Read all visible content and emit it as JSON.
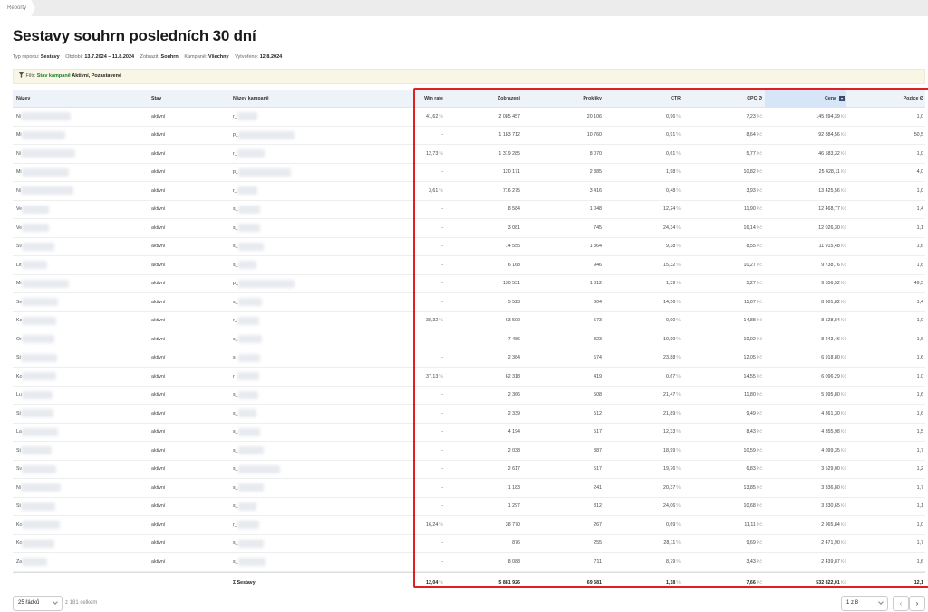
{
  "breadcrumb": {
    "label": "Reporty"
  },
  "page": {
    "title": "Sestavy souhrn posledních 30 dní"
  },
  "meta": [
    {
      "label": "Typ reportu:",
      "value": "Sestavy"
    },
    {
      "label": "Období:",
      "value": "13.7.2024 – 11.8.2024"
    },
    {
      "label": "Zobrazit:",
      "value": "Souhrn"
    },
    {
      "label": "Kampaně:",
      "value": "Všechny"
    },
    {
      "label": "Vytvořeno:",
      "value": "12.8.2024"
    }
  ],
  "filter": {
    "label": "Filtr:",
    "name": "Stav kampaně",
    "value": "Aktivní, Pozastavené"
  },
  "table": {
    "columns": {
      "nazev": "Název",
      "stav": "Stav",
      "kampan": "Název kampaně",
      "winrate": "Win rate",
      "zobrazeni": "Zobrazení",
      "prokliky": "Prokliky",
      "ctr": "CTR",
      "cpc": "CPC Ø",
      "cena": "Cena",
      "pozice": "Pozice Ø"
    },
    "units": {
      "pct": "%",
      "kc": "Kč"
    },
    "rows": [
      {
        "n": "Ni",
        "k": "r_",
        "stav": "aktivní",
        "winrate": "41,62",
        "zobrazeni": "2 085 457",
        "prokliky": "20 106",
        "ctr": "0,96",
        "cpc": "7,23",
        "cena": "145 394,39",
        "pozice": "1,0"
      },
      {
        "n": "Mi",
        "k": "p_",
        "stav": "aktivní",
        "winrate": "-",
        "zobrazeni": "1 183 712",
        "prokliky": "10 760",
        "ctr": "0,91",
        "cpc": "8,64",
        "cena": "92 884,56",
        "pozice": "50,5"
      },
      {
        "n": "Ni",
        "k": "r_",
        "stav": "aktivní",
        "winrate": "12,73",
        "zobrazeni": "1 319 285",
        "prokliky": "8 070",
        "ctr": "0,61",
        "cpc": "5,77",
        "cena": "46 583,32",
        "pozice": "1,0"
      },
      {
        "n": "Mi",
        "k": "p_",
        "stav": "aktivní",
        "winrate": "-",
        "zobrazeni": "120 171",
        "prokliky": "2 385",
        "ctr": "1,98",
        "cpc": "10,82",
        "cena": "25 428,11",
        "pozice": "4,0"
      },
      {
        "n": "Ni",
        "k": "r_",
        "stav": "aktivní",
        "winrate": "3,61",
        "zobrazeni": "716 275",
        "prokliky": "3 416",
        "ctr": "0,48",
        "cpc": "3,93",
        "cena": "13 425,56",
        "pozice": "1,0"
      },
      {
        "n": "Ve",
        "k": "s_",
        "stav": "aktivní",
        "winrate": "-",
        "zobrazeni": "8 584",
        "prokliky": "1 048",
        "ctr": "12,24",
        "cpc": "11,90",
        "cena": "12 468,77",
        "pozice": "1,4"
      },
      {
        "n": "Ve",
        "k": "s_",
        "stav": "aktivní",
        "winrate": "-",
        "zobrazeni": "3 081",
        "prokliky": "745",
        "ctr": "24,34",
        "cpc": "16,14",
        "cena": "12 026,30",
        "pozice": "1,1"
      },
      {
        "n": "Sv",
        "k": "s_",
        "stav": "aktivní",
        "winrate": "-",
        "zobrazeni": "14 555",
        "prokliky": "1 364",
        "ctr": "9,38",
        "cpc": "8,55",
        "cena": "11 915,48",
        "pozice": "1,6"
      },
      {
        "n": "Lit",
        "k": "s_",
        "stav": "aktivní",
        "winrate": "-",
        "zobrazeni": "6 168",
        "prokliky": "946",
        "ctr": "15,32",
        "cpc": "10,27",
        "cena": "9 738,76",
        "pozice": "1,6"
      },
      {
        "n": "Mi",
        "k": "p_",
        "stav": "aktivní",
        "winrate": "-",
        "zobrazeni": "130 531",
        "prokliky": "1 812",
        "ctr": "1,39",
        "cpc": "5,27",
        "cena": "9 556,52",
        "pozice": "49,5"
      },
      {
        "n": "Sv",
        "k": "s_",
        "stav": "aktivní",
        "winrate": "-",
        "zobrazeni": "5 523",
        "prokliky": "804",
        "ctr": "14,56",
        "cpc": "11,07",
        "cena": "8 901,82",
        "pozice": "1,4"
      },
      {
        "n": "Ko",
        "k": "r_",
        "stav": "aktivní",
        "winrate": "38,32",
        "zobrazeni": "63 500",
        "prokliky": "573",
        "ctr": "0,90",
        "cpc": "14,88",
        "cena": "8 528,84",
        "pozice": "1,0"
      },
      {
        "n": "Or",
        "k": "s_",
        "stav": "aktivní",
        "winrate": "-",
        "zobrazeni": "7 486",
        "prokliky": "823",
        "ctr": "10,99",
        "cpc": "10,02",
        "cena": "8 243,46",
        "pozice": "1,6"
      },
      {
        "n": "St",
        "k": "s_",
        "stav": "aktivní",
        "winrate": "-",
        "zobrazeni": "2 384",
        "prokliky": "574",
        "ctr": "23,88",
        "cpc": "12,05",
        "cena": "6 918,80",
        "pozice": "1,6"
      },
      {
        "n": "Ko",
        "k": "r_",
        "stav": "aktivní",
        "winrate": "37,13",
        "zobrazeni": "62 318",
        "prokliky": "419",
        "ctr": "0,67",
        "cpc": "14,55",
        "cena": "6 096,29",
        "pozice": "1,0"
      },
      {
        "n": "Lu",
        "k": "s_",
        "stav": "aktivní",
        "winrate": "-",
        "zobrazeni": "2 366",
        "prokliky": "508",
        "ctr": "21,47",
        "cpc": "11,80",
        "cena": "5 995,80",
        "pozice": "1,6"
      },
      {
        "n": "St",
        "k": "s_",
        "stav": "aktivní",
        "winrate": "-",
        "zobrazeni": "2 339",
        "prokliky": "512",
        "ctr": "21,89",
        "cpc": "9,49",
        "cena": "4 861,30",
        "pozice": "1,6"
      },
      {
        "n": "La",
        "k": "s_",
        "stav": "aktivní",
        "winrate": "-",
        "zobrazeni": "4 194",
        "prokliky": "517",
        "ctr": "12,33",
        "cpc": "8,43",
        "cena": "4 355,98",
        "pozice": "1,5"
      },
      {
        "n": "St",
        "k": "s_",
        "stav": "aktivní",
        "winrate": "-",
        "zobrazeni": "2 038",
        "prokliky": "387",
        "ctr": "18,99",
        "cpc": "10,59",
        "cena": "4 099,35",
        "pozice": "1,7"
      },
      {
        "n": "Sv",
        "k": "s_",
        "stav": "aktivní",
        "winrate": "-",
        "zobrazeni": "2 617",
        "prokliky": "517",
        "ctr": "19,76",
        "cpc": "6,83",
        "cena": "3 529,00",
        "pozice": "1,2"
      },
      {
        "n": "Ni",
        "k": "s_",
        "stav": "aktivní",
        "winrate": "-",
        "zobrazeni": "1 183",
        "prokliky": "241",
        "ctr": "20,37",
        "cpc": "13,85",
        "cena": "3 336,80",
        "pozice": "1,7"
      },
      {
        "n": "St",
        "k": "s_",
        "stav": "aktivní",
        "winrate": "-",
        "zobrazeni": "1 297",
        "prokliky": "312",
        "ctr": "24,06",
        "cpc": "10,68",
        "cena": "3 330,65",
        "pozice": "1,1"
      },
      {
        "n": "Ko",
        "k": "r_",
        "stav": "aktivní",
        "winrate": "16,24",
        "zobrazeni": "38 770",
        "prokliky": "267",
        "ctr": "0,69",
        "cpc": "11,11",
        "cena": "2 965,84",
        "pozice": "1,0"
      },
      {
        "n": "Ko",
        "k": "s_",
        "stav": "aktivní",
        "winrate": "-",
        "zobrazeni": "876",
        "prokliky": "255",
        "ctr": "28,11",
        "cpc": "9,69",
        "cena": "2 471,90",
        "pozice": "1,7"
      },
      {
        "n": "Ža",
        "k": "s_",
        "stav": "aktivní",
        "winrate": "-",
        "zobrazeni": "8 088",
        "prokliky": "711",
        "ctr": "8,79",
        "cpc": "3,43",
        "cena": "2 439,87",
        "pozice": "1,6"
      }
    ],
    "total": {
      "label": "Σ Sestavy",
      "winrate": "12,04",
      "zobrazeni": "5 881 926",
      "prokliky": "69 581",
      "ctr": "1,18",
      "cpc": "7,66",
      "cena": "532 822,01",
      "pozice": "12,1"
    }
  },
  "footer": {
    "rows_select": "25 řádků",
    "count": "z 181 celkem",
    "page_select": "1 z 8",
    "prev": "‹",
    "next": "›"
  }
}
